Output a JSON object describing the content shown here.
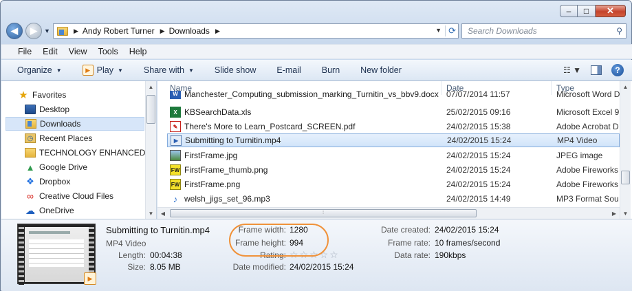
{
  "window": {
    "minimize": "–",
    "maximize": "□",
    "close": "✕"
  },
  "address": {
    "breadcrumb": [
      "Andy Robert Turner",
      "Downloads"
    ],
    "search_placeholder": "Search Downloads"
  },
  "menu": [
    "File",
    "Edit",
    "View",
    "Tools",
    "Help"
  ],
  "toolbar": {
    "organize": "Organize",
    "play": "Play",
    "share_with": "Share with",
    "slide_show": "Slide show",
    "email": "E-mail",
    "burn": "Burn",
    "new_folder": "New folder"
  },
  "sidebar": {
    "items": [
      {
        "label": "Favorites",
        "icon": "star-icon"
      },
      {
        "label": "Desktop",
        "icon": "desktop-icon"
      },
      {
        "label": "Downloads",
        "icon": "downloads-folder-icon"
      },
      {
        "label": "Recent Places",
        "icon": "recent-places-icon"
      },
      {
        "label": "TECHNOLOGY ENHANCED L",
        "icon": "folder-icon"
      },
      {
        "label": "Google Drive",
        "icon": "google-drive-icon"
      },
      {
        "label": "Dropbox",
        "icon": "dropbox-icon"
      },
      {
        "label": "Creative Cloud Files",
        "icon": "creative-cloud-icon"
      },
      {
        "label": "OneDrive",
        "icon": "onedrive-icon"
      }
    ]
  },
  "columns": {
    "name": "Name",
    "date": "Date",
    "type": "Type"
  },
  "files": [
    {
      "name": "Manchester_Computing_submission_marking_Turnitin_vs_bbv9.docx",
      "date": "07/07/2014 11:57",
      "type": "Microsoft Word D",
      "icon": "word-icon"
    },
    {
      "name": "KBSearchData.xls",
      "date": "25/02/2015 09:16",
      "type": "Microsoft Excel 9",
      "icon": "excel-icon"
    },
    {
      "name": "There's More to Learn_Postcard_SCREEN.pdf",
      "date": "24/02/2015 15:38",
      "type": "Adobe Acrobat D",
      "icon": "pdf-icon"
    },
    {
      "name": "Submitting to Turnitin.mp4",
      "date": "24/02/2015 15:24",
      "type": "MP4 Video",
      "icon": "video-icon"
    },
    {
      "name": "FirstFrame.jpg",
      "date": "24/02/2015 15:24",
      "type": "JPEG image",
      "icon": "image-icon"
    },
    {
      "name": "FirstFrame_thumb.png",
      "date": "24/02/2015 15:24",
      "type": "Adobe Fireworks",
      "icon": "fireworks-icon"
    },
    {
      "name": "FirstFrame.png",
      "date": "24/02/2015 15:24",
      "type": "Adobe Fireworks",
      "icon": "fireworks-icon"
    },
    {
      "name": "welsh_jigs_set_96.mp3",
      "date": "24/02/2015 14:49",
      "type": "MP3 Format Sou",
      "icon": "audio-icon"
    }
  ],
  "details": {
    "title": "Submitting to Turnitin.mp4",
    "type": "MP4 Video",
    "length_label": "Length:",
    "length": "00:04:38",
    "size_label": "Size:",
    "size": "8.05 MB",
    "frame_width_label": "Frame width:",
    "frame_width": "1280",
    "frame_height_label": "Frame height:",
    "frame_height": "994",
    "rating_label": "Rating:",
    "rating": "☆☆☆☆☆",
    "date_modified_label": "Date modified:",
    "date_modified": "24/02/2015 15:24",
    "date_created_label": "Date created:",
    "date_created": "24/02/2015 15:24",
    "frame_rate_label": "Frame rate:",
    "frame_rate": "10 frames/second",
    "data_rate_label": "Data rate:",
    "data_rate": "190kbps"
  },
  "colors": {
    "highlight": "#f0923a",
    "selection": "#d1e4fa"
  }
}
